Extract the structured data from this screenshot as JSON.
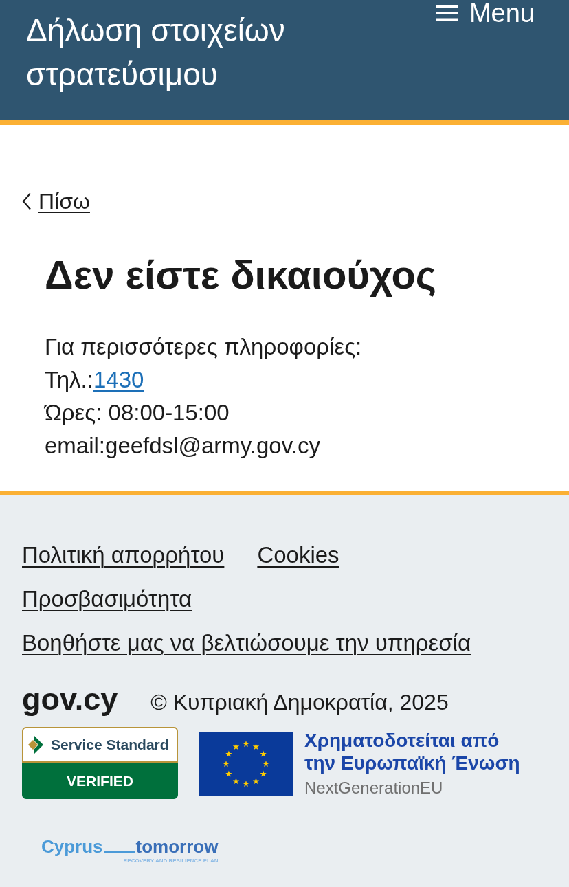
{
  "header": {
    "title": "Δήλωση στοιχείων στρατεύσιμου",
    "menu_label": "Menu"
  },
  "back_link": "Πίσω",
  "heading": "Δεν είστε δικαιούχος",
  "info": {
    "intro": "Για περισσότερες πληροφορίες:",
    "phone_label": "Τηλ.:",
    "phone": "1430",
    "hours": "Ώρες: 08:00-15:00",
    "email": "email:geefdsl@army.gov.cy"
  },
  "footer": {
    "links": [
      "Πολιτική απορρήτου",
      "Cookies",
      "Προσβασιμότητα",
      "Βοηθήστε μας να βελτιώσουμε την υπηρεσία"
    ],
    "logo": "gov.cy",
    "copyright": "© Κυπριακή Δημοκρατία, 2025",
    "badge": {
      "title": "Service Standard",
      "status": "VERIFIED"
    },
    "eu": {
      "lines": [
        "Χρηματοδοτείται από",
        "την Ευρωπαϊκή Ένωση"
      ],
      "subtitle": "NextGenerationEU"
    },
    "recovery_logo": {
      "left_word": "Cyprus",
      "right_word": "tomorrow",
      "tagline": "RECOVERY AND RESILIENCE PLAN"
    }
  }
}
